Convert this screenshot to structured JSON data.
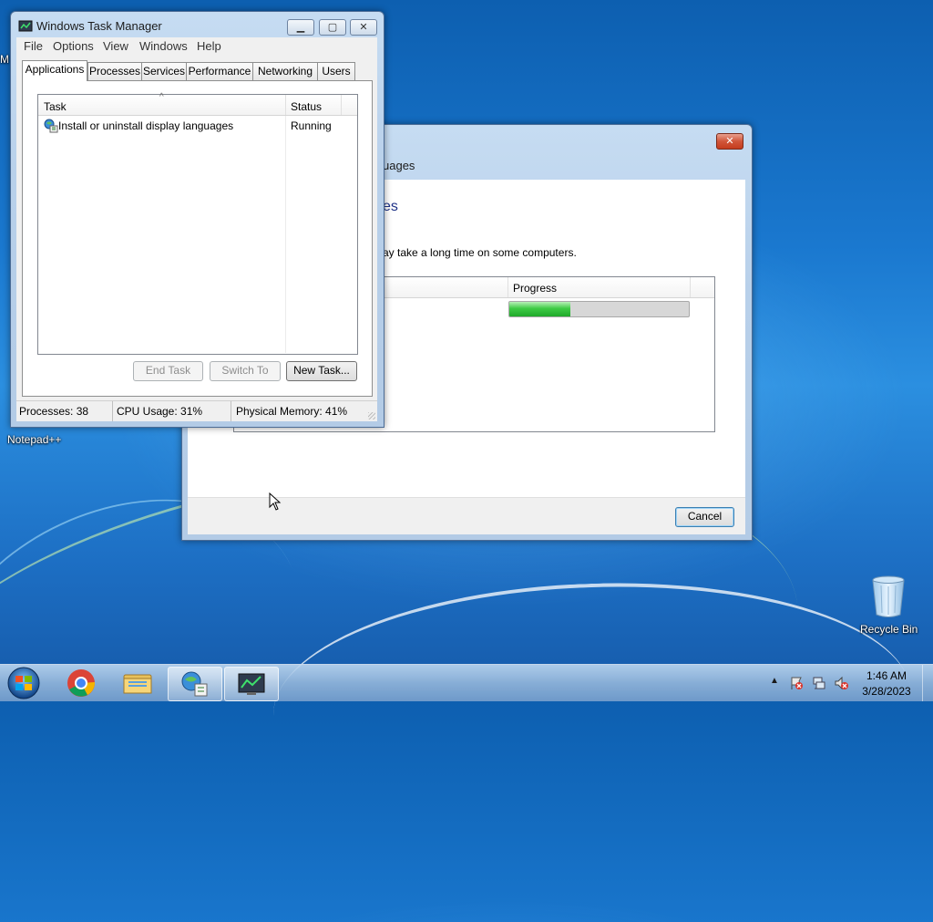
{
  "desktop": {
    "left_icon_partial_label": "M",
    "notepad_label": "Notepad++",
    "recycle_bin_label": "Recycle Bin"
  },
  "installer": {
    "close_glyph": "✕",
    "title_partial": "uages",
    "heading_partial": "es",
    "message_partial": "ay take a long time on some computers.",
    "progress_header": "Progress",
    "progress_percent": 34,
    "cancel_label": "Cancel",
    "colors": {
      "progress_fill": "#2fbf3a",
      "progress_track": "#d7d7d7"
    }
  },
  "taskmgr": {
    "title": "Windows Task Manager",
    "caption": {
      "minimize": "▁",
      "maximize": "▢",
      "close": "✕"
    },
    "menu": [
      "File",
      "Options",
      "View",
      "Windows",
      "Help"
    ],
    "tabs": [
      "Applications",
      "Processes",
      "Services",
      "Performance",
      "Networking",
      "Users"
    ],
    "active_tab": "Applications",
    "columns": {
      "task": "Task",
      "status": "Status",
      "sort_glyph": "^"
    },
    "rows": [
      {
        "task": "Install or uninstall display languages",
        "status": "Running"
      }
    ],
    "buttons": {
      "end_task": "End Task",
      "switch_to": "Switch To",
      "new_task": "New Task..."
    },
    "status": {
      "processes": "Processes: 38",
      "cpu": "CPU Usage: 31%",
      "memory": "Physical Memory: 41%"
    }
  },
  "taskbar": {
    "tray_arrow": "▲",
    "time": "1:46 AM",
    "date": "3/28/2023",
    "colors": {
      "accent": "#1a78cf"
    }
  }
}
